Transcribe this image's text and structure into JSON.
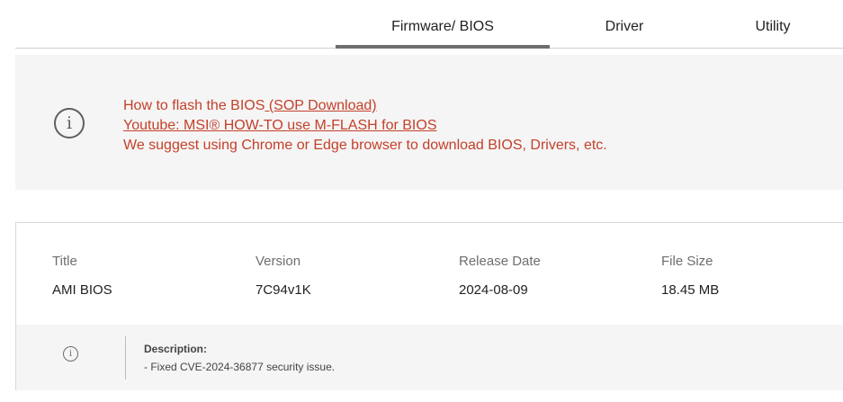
{
  "tabs": {
    "firmware_label": "Firmware/ BIOS",
    "driver_label": "Driver",
    "utility_label": "Utility",
    "active": "Firmware/ BIOS"
  },
  "notice": {
    "icon": "info-icon",
    "line1_text": "How to flash the BIOS",
    "line1_link": " (SOP Download)",
    "line2_link": "Youtube: MSI® HOW-TO use M-FLASH for BIOS",
    "line3_text": "We suggest using Chrome or Edge browser to download BIOS, Drivers, etc.",
    "text_color": "#c4402a"
  },
  "download": {
    "headers": {
      "title": "Title",
      "version": "Version",
      "release_date": "Release Date",
      "file_size": "File Size"
    },
    "values": {
      "title": "AMI BIOS",
      "version": "7C94v1K",
      "release_date": "2024-08-09",
      "file_size": "18.45 MB"
    },
    "description": {
      "icon": "info-icon",
      "label": "Description:",
      "text": "- Fixed CVE-2024-36877 security issue."
    }
  }
}
